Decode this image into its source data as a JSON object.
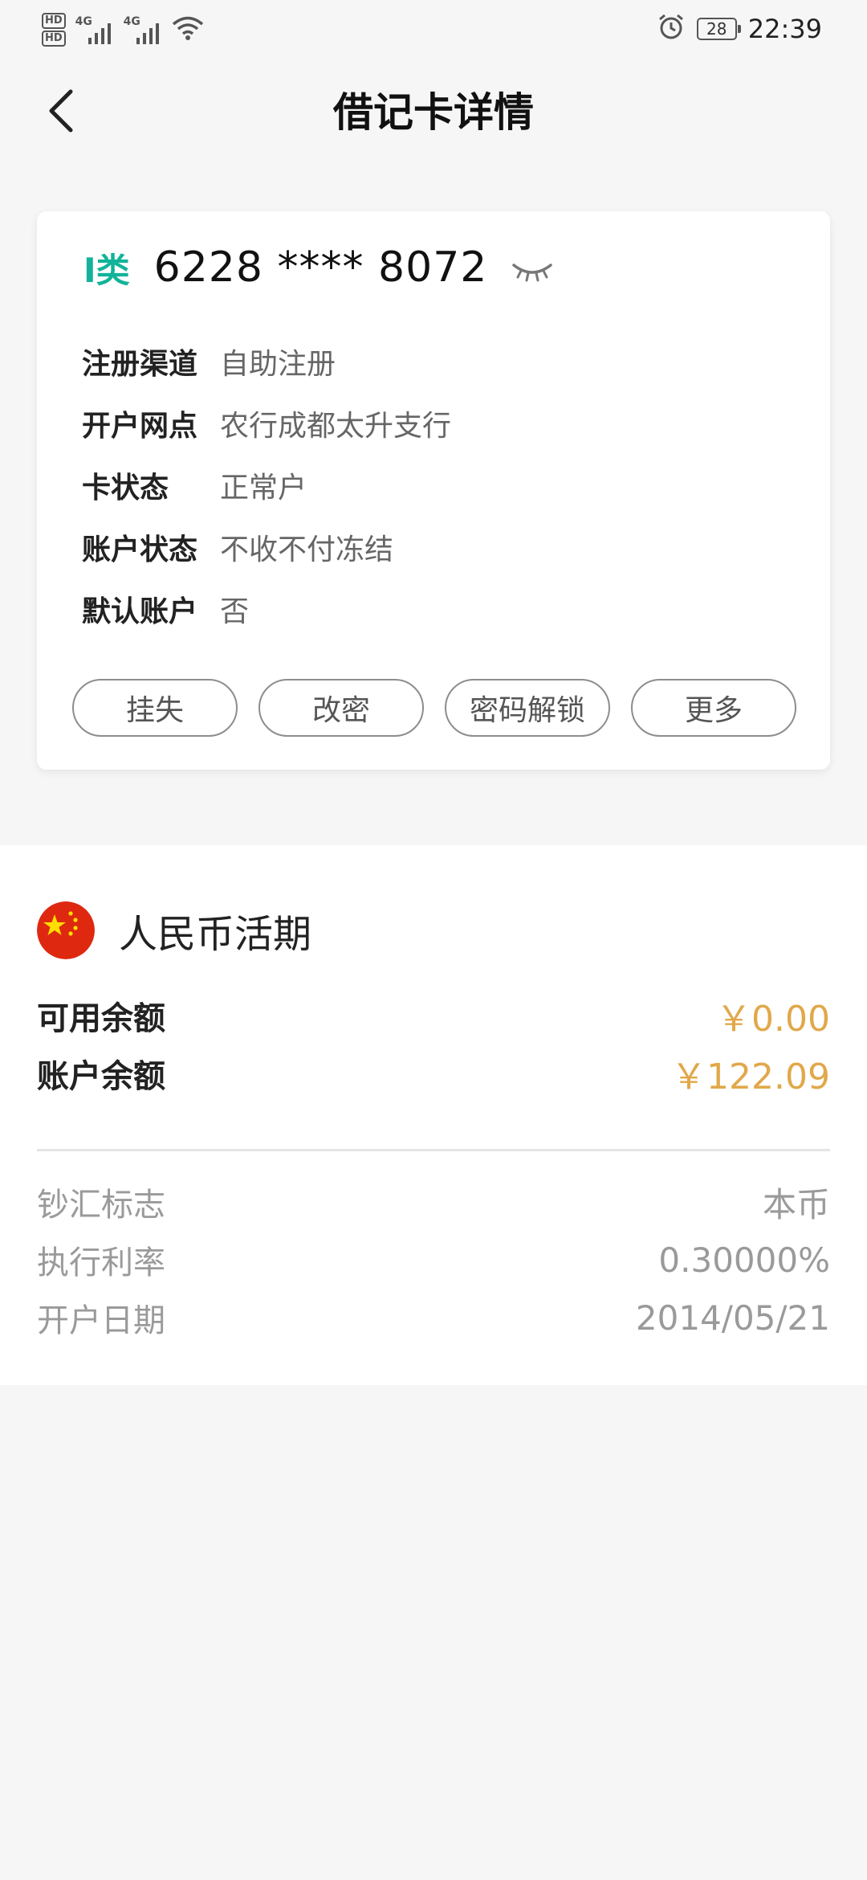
{
  "status_bar": {
    "hd1": "HD",
    "hd2": "HD",
    "net1": "4G",
    "net2": "4G",
    "battery": "28",
    "time": "22:39",
    "icons": [
      "hd-icon",
      "signal-icon",
      "wifi-icon",
      "alarm-icon",
      "battery-icon"
    ]
  },
  "header": {
    "title": "借记卡详情",
    "back_icon": "chevron-left-icon"
  },
  "card": {
    "type_label": "I类",
    "number": "6228 **** 8072",
    "eye_icon": "eye-closed-icon",
    "type_color": "#12b39a",
    "info": [
      {
        "label": "注册渠道",
        "value": "自助注册"
      },
      {
        "label": "开户网点",
        "value": "农行成都太升支行"
      },
      {
        "label": "卡状态",
        "value": "正常户"
      },
      {
        "label": "账户状态",
        "value": "不收不付冻结"
      },
      {
        "label": "默认账户",
        "value": "否"
      }
    ],
    "actions": [
      "挂失",
      "改密",
      "密码解锁",
      "更多"
    ]
  },
  "account": {
    "flag_icon": "china-flag-icon",
    "title": "人民币活期",
    "available_label": "可用余额",
    "available_value": "￥0.00",
    "balance_label": "账户余额",
    "balance_value": "￥122.09",
    "amount_color": "#e1a84a",
    "details": [
      {
        "label": "钞汇标志",
        "value": "本币"
      },
      {
        "label": "执行利率",
        "value": "0.30000%"
      },
      {
        "label": "开户日期",
        "value": "2014/05/21"
      }
    ]
  }
}
